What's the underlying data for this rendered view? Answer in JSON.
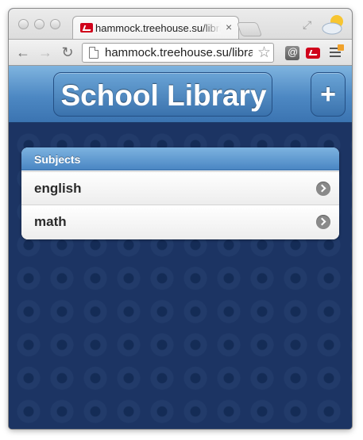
{
  "browser": {
    "tab_title": "hammock.treehouse.su/library",
    "tab_close": "×",
    "url": "hammock.treehouse.su/library"
  },
  "app": {
    "title": "School Library",
    "add_label": "+"
  },
  "subjects": {
    "header": "Subjects",
    "items": [
      {
        "label": "english"
      },
      {
        "label": "math"
      }
    ]
  },
  "colors": {
    "header_blue": "#4d88c3",
    "background_navy": "#1c3463",
    "chevron_gray": "#8a8a8a"
  },
  "icons": [
    "back-icon",
    "forward-icon",
    "reload-icon",
    "page-icon",
    "star-icon",
    "menu-icon",
    "chevron-right-icon",
    "weather-icon"
  ]
}
